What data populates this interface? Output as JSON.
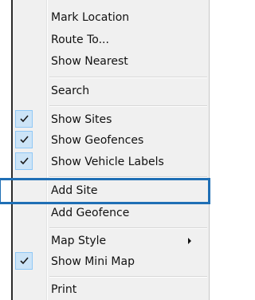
{
  "menu": {
    "items": [
      {
        "label": "Mark Location",
        "checked": false
      },
      {
        "label": "Route To...",
        "checked": false
      },
      {
        "label": "Show Nearest",
        "checked": false
      },
      {
        "label": "Search",
        "checked": false
      },
      {
        "label": "Show Sites",
        "checked": true
      },
      {
        "label": "Show Geofences",
        "checked": true
      },
      {
        "label": "Show Vehicle Labels",
        "checked": true
      },
      {
        "label": "Add Site",
        "checked": false,
        "highlighted": true
      },
      {
        "label": "Add Geofence",
        "checked": false
      },
      {
        "label": "Map Style",
        "checked": false,
        "has_submenu": true
      },
      {
        "label": "Show Mini Map",
        "checked": true
      },
      {
        "label": "Print",
        "checked": false
      }
    ]
  },
  "colors": {
    "menu_background": "#f0f0f0",
    "check_background": "#cce4f7",
    "check_border": "#90c8f6",
    "highlight_border": "#1f6fb5"
  }
}
